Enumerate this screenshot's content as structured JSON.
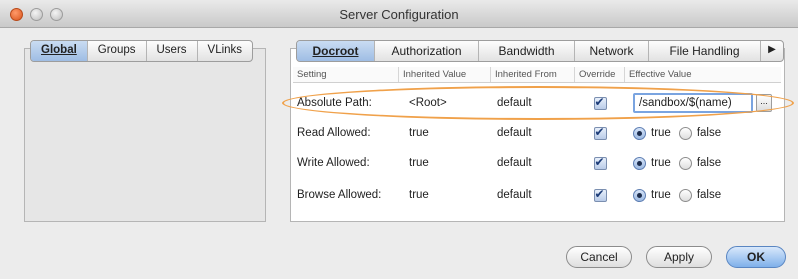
{
  "window": {
    "title": "Server Configuration"
  },
  "left_tabs": [
    "Global",
    "Groups",
    "Users",
    "VLinks"
  ],
  "right_tabs": [
    "Docroot",
    "Authorization",
    "Bandwidth",
    "Network",
    "File Handling"
  ],
  "tab_scroll_label": "▶",
  "table": {
    "headers": [
      "Setting",
      "Inherited Value",
      "Inherited From",
      "Override",
      "Effective Value"
    ],
    "rows": [
      {
        "setting": "Absolute Path:",
        "inherited": "<Root>",
        "from": "default",
        "override": true,
        "effective": "/sandbox/$(name)"
      },
      {
        "setting": "Read Allowed:",
        "inherited": "true",
        "from": "default",
        "override": true,
        "effective": "true"
      },
      {
        "setting": "Write Allowed:",
        "inherited": "true",
        "from": "default",
        "override": true,
        "effective": "true"
      },
      {
        "setting": "Browse Allowed:",
        "inherited": "true",
        "from": "default",
        "override": true,
        "effective": "true"
      }
    ],
    "radio_true_label": "true",
    "radio_false_label": "false",
    "browse_button_label": "..."
  },
  "buttons": {
    "cancel": "Cancel",
    "apply": "Apply",
    "ok": "OK"
  },
  "colors": {
    "highlight": "#f0a14a",
    "selected_tab": "#9fbde4"
  }
}
